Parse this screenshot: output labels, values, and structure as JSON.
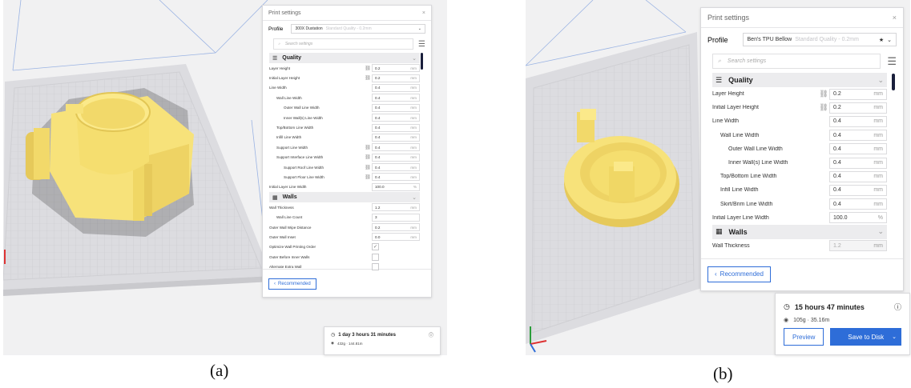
{
  "panel_a": {
    "title": "Print settings",
    "close": "×",
    "profile_label": "Profile",
    "profile_value": "300X Dustation",
    "profile_sub": "Standard Quality - 0.2mm",
    "search_placeholder": "Search settings",
    "categories": {
      "quality": "Quality",
      "walls": "Walls"
    },
    "quality_rows": [
      {
        "label": "Layer Height",
        "value": "0.2",
        "unit": "mm"
      },
      {
        "label": "Initial Layer Height",
        "value": "0.2",
        "unit": "mm"
      },
      {
        "label": "Line Width",
        "value": "0.4",
        "unit": "mm"
      },
      {
        "label": "Wall Line Width",
        "value": "0.4",
        "unit": "mm"
      },
      {
        "label": "Outer Wall Line Width",
        "value": "0.4",
        "unit": "mm"
      },
      {
        "label": "Inner Wall(s) Line Width",
        "value": "0.4",
        "unit": "mm"
      },
      {
        "label": "Top/Bottom Line Width",
        "value": "0.4",
        "unit": "mm"
      },
      {
        "label": "Infill Line Width",
        "value": "0.4",
        "unit": "mm"
      },
      {
        "label": "Support Line Width",
        "value": "0.4",
        "unit": "mm"
      },
      {
        "label": "Support Interface Line Width",
        "value": "0.4",
        "unit": "mm"
      },
      {
        "label": "Support Roof Line Width",
        "value": "0.4",
        "unit": "mm"
      },
      {
        "label": "Support Floor Line Width",
        "value": "0.4",
        "unit": "mm"
      },
      {
        "label": "Initial Layer Line Width",
        "value": "100.0",
        "unit": "%"
      }
    ],
    "walls_rows": [
      {
        "label": "Wall Thickness",
        "value": "1.2",
        "unit": "mm"
      },
      {
        "label": "Wall Line Count",
        "value": "3",
        "unit": ""
      },
      {
        "label": "Outer Wall Wipe Distance",
        "value": "0.2",
        "unit": "mm"
      },
      {
        "label": "Outer Wall Inset",
        "value": "0.0",
        "unit": "mm"
      },
      {
        "label": "Optimize Wall Printing Order",
        "value": "✓"
      },
      {
        "label": "Outer Before Inner Walls",
        "value": ""
      },
      {
        "label": "Alternate Extra Wall",
        "value": ""
      }
    ],
    "recommended": "Recommended",
    "time": "1 day 3 hours 31 minutes",
    "material": "432g · 144.81m",
    "caption": "(a)"
  },
  "panel_b": {
    "title": "Print settings",
    "close": "×",
    "profile_label": "Profile",
    "profile_value": "Ben's TPU Bellow",
    "profile_sub": "Standard Quality - 0.2mm",
    "search_placeholder": "Search settings",
    "categories": {
      "quality": "Quality",
      "walls": "Walls"
    },
    "quality_rows": [
      {
        "label": "Layer Height",
        "value": "0.2",
        "unit": "mm"
      },
      {
        "label": "Initial Layer Height",
        "value": "0.2",
        "unit": "mm"
      },
      {
        "label": "Line Width",
        "value": "0.4",
        "unit": "mm"
      },
      {
        "label": "Wall Line Width",
        "value": "0.4",
        "unit": "mm"
      },
      {
        "label": "Outer Wall Line Width",
        "value": "0.4",
        "unit": "mm"
      },
      {
        "label": "Inner Wall(s) Line Width",
        "value": "0.4",
        "unit": "mm"
      },
      {
        "label": "Top/Bottom Line Width",
        "value": "0.4",
        "unit": "mm"
      },
      {
        "label": "Infill Line Width",
        "value": "0.4",
        "unit": "mm"
      },
      {
        "label": "Skirt/Brim Line Width",
        "value": "0.4",
        "unit": "mm"
      },
      {
        "label": "Initial Layer Line Width",
        "value": "100.0",
        "unit": "%"
      }
    ],
    "walls_rows": [
      {
        "label": "Wall Thickness",
        "value": "1.2",
        "unit": "mm"
      }
    ],
    "recommended": "Recommended",
    "time": "15 hours 47 minutes",
    "material": "105g · 35.16m",
    "preview": "Preview",
    "save": "Save to Disk",
    "caption": "(b)"
  },
  "colors": {
    "accent": "#2e6dd8",
    "model": "#f7e27a",
    "model_dark": "#e6c95a",
    "plate": "#dcdce0"
  }
}
